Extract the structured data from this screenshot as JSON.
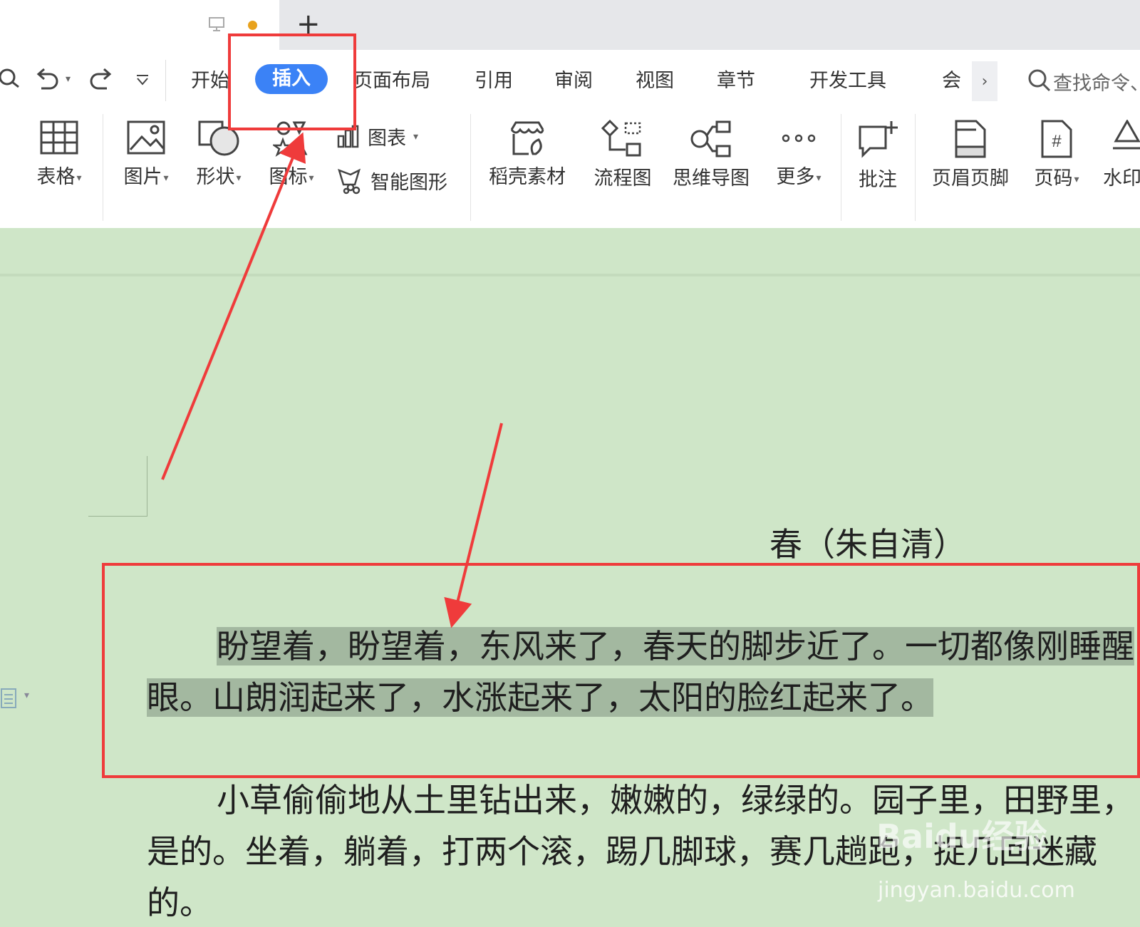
{
  "menu": {
    "tabs": [
      "开始",
      "插入",
      "页面布局",
      "引用",
      "审阅",
      "视图",
      "章节",
      "开发工具"
    ],
    "active_tab": "插入",
    "overflow_tab": "会",
    "overflow_arrow": "›",
    "search_placeholder": "查找命令、"
  },
  "ribbon": {
    "table": "表格",
    "picture": "图片",
    "shape": "形状",
    "icons": "图标",
    "chart": "图表",
    "smart_graphic": "智能图形",
    "docer_material": "稻壳素材",
    "flowchart": "流程图",
    "mindmap": "思维导图",
    "more": "更多",
    "comment": "批注",
    "header_footer": "页眉页脚",
    "page_number": "页码",
    "watermark": "水印"
  },
  "document": {
    "title": "春（朱自清）",
    "para1_line1": "盼望着，盼望着，东风来了，春天的脚步近了。一切都像刚睡醒",
    "para1_line2": "眼。山朗润起来了，水涨起来了，太阳的脸红起来了。",
    "para2_line1": "小草偷偷地从土里钻出来，嫩嫩的，绿绿的。园子里，田野里，",
    "para2_line2": "是的。坐着，躺着，打两个滚，踢几脚球，赛几趟跑，捉几回迷藏",
    "para2_line3": "的。"
  },
  "site_watermark": {
    "text": "Baidu经验",
    "url": "jingyan.baidu.com"
  },
  "colors": {
    "accent": "#3b82f6",
    "highlight_red": "#ef3b3b",
    "doc_background": "#cfe6c8",
    "selection": "#a3b8a0"
  }
}
